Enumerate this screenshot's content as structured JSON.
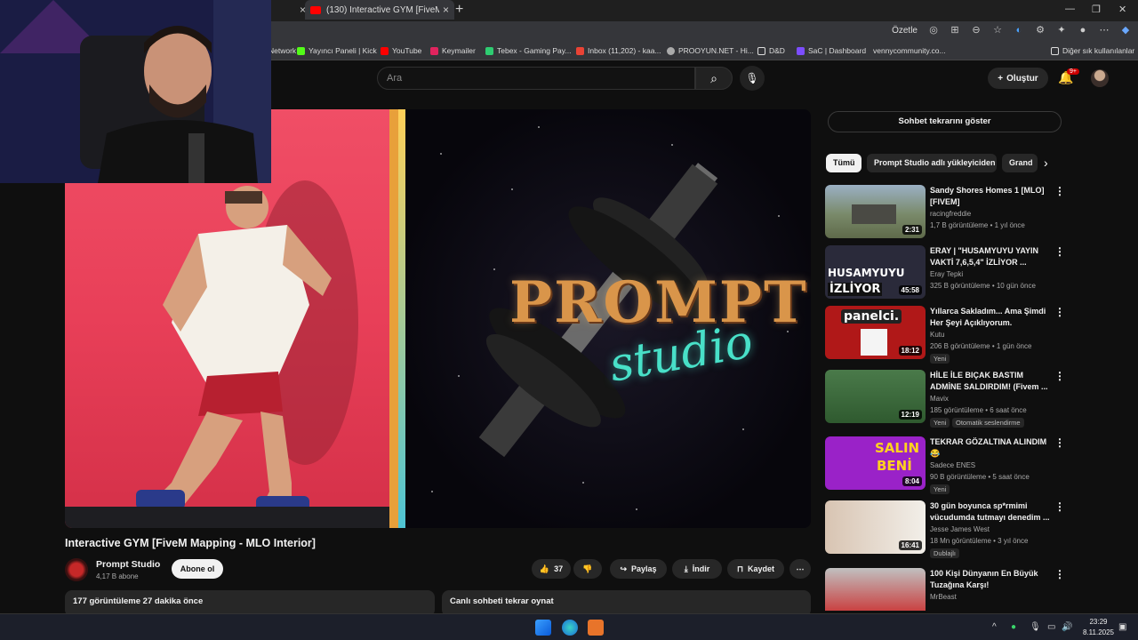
{
  "browser": {
    "active_tab_title": "(130) Interactive GYM [FiveM Mapping - MLO Interior] - YouTube",
    "translate_label": "Özetle",
    "bookmarks": [
      {
        "label": "Network",
        "color": "#3ea6ff"
      },
      {
        "label": "Yayıncı Paneli | Kick",
        "color": "#53fc18"
      },
      {
        "label": "YouTube",
        "color": "#ff0000"
      },
      {
        "label": "Keymailer",
        "color": "#e0245e"
      },
      {
        "label": "Tebex - Gaming Pay...",
        "color": "#2ecc71"
      },
      {
        "label": "Inbox (11,202) - kaa...",
        "color": "#ea4335"
      },
      {
        "label": "PROOYUN.NET - Hi...",
        "color": "#aaaaaa"
      },
      {
        "label": "D&D",
        "color": "#f5c542"
      },
      {
        "label": "SaC | Dashboard",
        "color": "#7c4dff"
      },
      {
        "label": "vennycommunity.co...",
        "color": "#888888"
      }
    ],
    "other_bookmarks": "Diğer sık kullanılanlar"
  },
  "header": {
    "search_placeholder": "Ara",
    "create_label": "Oluştur",
    "notifications_badge": "9+"
  },
  "video": {
    "brand_main": "PROMPT",
    "brand_sub": "studio",
    "title": "Interactive GYM [FiveM Mapping - MLO Interior]",
    "channel": "Prompt Studio",
    "subscribers": "4,17 B abone",
    "subscribe_label": "Abone ol",
    "likes": "37",
    "share_label": "Paylaş",
    "download_label": "İndir",
    "save_label": "Kaydet",
    "views_and_time": "177 görüntüleme  27 dakika önce",
    "chat_replay_label": "Canlı sohbeti tekrar oynat"
  },
  "sidebar": {
    "show_chat_label": "Sohbet tekrarını göster",
    "chips": [
      "Tümü",
      "Prompt Studio adlı yükleyiciden",
      "Grand"
    ],
    "recommendations": [
      {
        "title": "Sandy Shores Homes 1 [MLO] [FIVEM]",
        "channel": "racingfreddie",
        "meta": "1,7 B görüntüleme • 1 yıl önce",
        "duration": "2:31",
        "badges": [],
        "thumb_color": "#7a8a6a"
      },
      {
        "title": "ERAY | \"HUSAMYUYU YAYIN VAKTİ 7,6,5,4\" İZLİYOR ...",
        "channel": "Eray Tepki",
        "meta": "325 B görüntüleme • 10 gün önce",
        "duration": "45:58",
        "badges": [],
        "thumb_color": "#2a2a3a",
        "thumb_text": "HUSAMYUYU",
        "thumb_text2": "İZLİYOR"
      },
      {
        "title": "Yıllarca Sakladım... Ama Şimdi Her Şeyi Açıklıyorum.",
        "channel": "Kutu",
        "meta": "206 B görüntüleme • 1 gün önce",
        "duration": "18:12",
        "badges": [
          "Yeni"
        ],
        "thumb_color": "#b01818",
        "thumb_text": "panelci."
      },
      {
        "title": "HİLE İLE BIÇAK BASTIM ADMİNE SALDIRDIM! (Fivem ...",
        "channel": "Mavix",
        "meta": "185 görüntüleme • 6 saat önce",
        "duration": "12:19",
        "badges": [
          "Yeni",
          "Otomatik seslendirme"
        ],
        "thumb_color": "#3a6a3a"
      },
      {
        "title": "TEKRAR GÖZALTINA ALINDIM 😂",
        "channel": "Sadece ENES",
        "meta": "90 B görüntüleme • 5 saat önce",
        "duration": "8:04",
        "badges": [
          "Yeni"
        ],
        "thumb_color": "#9a22c8",
        "thumb_text": "SALIN",
        "thumb_text2": "BENİ"
      },
      {
        "title": "30 gün boyunca sp*rmimi vücudumda tutmayı denedim ...",
        "channel": "Jesse James West",
        "meta": "18 Mn görüntüleme • 3 yıl önce",
        "duration": "16:41",
        "badges": [
          "Dublajlı"
        ],
        "thumb_color": "#c8b8a8"
      },
      {
        "title": "100 Kişi Dünyanın En Büyük Tuzağına Karşı!",
        "channel": "MrBeast",
        "meta": "",
        "duration": "",
        "badges": [],
        "thumb_color": "#cc2222"
      }
    ]
  },
  "taskbar": {
    "time": "23:29",
    "date": "8.11.2025"
  }
}
